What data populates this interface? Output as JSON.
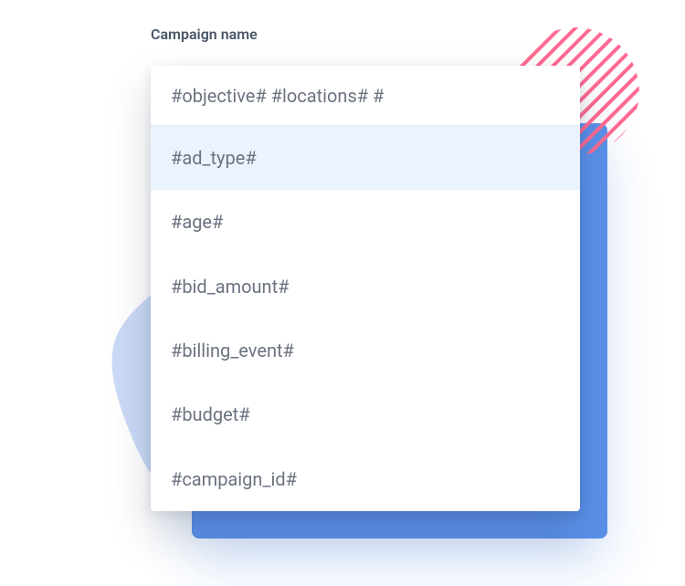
{
  "field": {
    "label": "Campaign name",
    "input_value": "#objective# #locations# #"
  },
  "dropdown": {
    "highlighted_index": 0,
    "options": [
      "#ad_type#",
      "#age#",
      "#bid_amount#",
      "#billing_event#",
      "#budget#",
      "#campaign_id#"
    ]
  },
  "colors": {
    "accent_blue": "#4a86e8",
    "light_blue": "#a9c3f2",
    "stripe_pink": "#ff6a92"
  }
}
